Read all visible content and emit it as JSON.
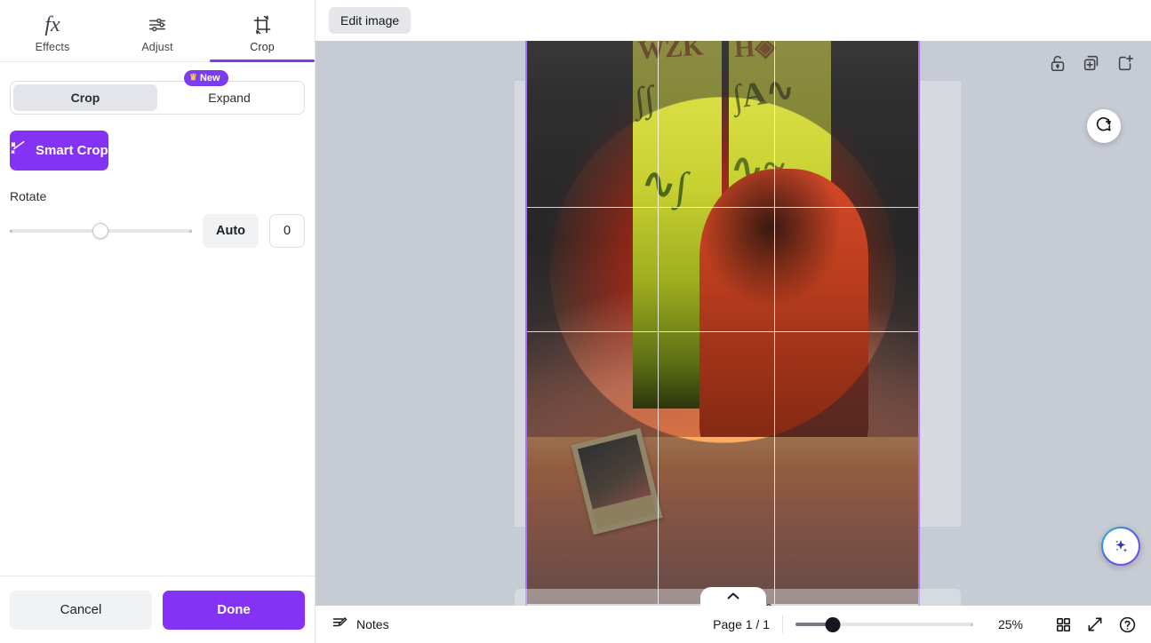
{
  "sidebar": {
    "tabs": [
      {
        "label": "Effects",
        "icon": "fx-icon",
        "active": false
      },
      {
        "label": "Adjust",
        "icon": "sliders-icon",
        "active": false
      },
      {
        "label": "Crop",
        "icon": "crop-rotate-icon",
        "active": true
      }
    ],
    "segment": {
      "crop_label": "Crop",
      "expand_label": "Expand",
      "new_badge": "New",
      "crown_icon": "crown-icon",
      "selected": "Crop"
    },
    "smart_crop": {
      "label": "Smart Crop",
      "icon": "magic-wand-icon",
      "color": "#8433f5"
    },
    "rotate": {
      "label": "Rotate",
      "slider_value": 0,
      "slider_percent": 50,
      "auto_label": "Auto",
      "value_text": "0"
    },
    "footer": {
      "cancel_label": "Cancel",
      "done_label": "Done",
      "done_color": "#8433f5"
    }
  },
  "topbar": {
    "edit_image_label": "Edit image"
  },
  "canvas": {
    "background_color": "#c7cbd4",
    "page_tools": [
      {
        "name": "lock-icon",
        "title": "Lock"
      },
      {
        "name": "duplicate-page-icon",
        "title": "Duplicate page"
      },
      {
        "name": "add-page-icon",
        "title": "Add page"
      }
    ],
    "add_page_label": "+ Add page",
    "comment_icon": "comment-add-icon",
    "magic_icon": "sparkle-icon",
    "collapse_icon": "chevron-up-icon",
    "crop": {
      "shape": "circle",
      "grid": "rule-of-thirds",
      "guide_color": "#a974f7",
      "scrim_color": "rgba(35,38,44,0.46)"
    }
  },
  "statusbar": {
    "notes_label": "Notes",
    "notes_icon": "notes-icon",
    "page_indicator": "Page 1 / 1",
    "zoom_label": "25%",
    "zoom_percent": 21,
    "grid_view_icon": "grid-view-icon",
    "fullscreen_icon": "expand-arrows-icon",
    "help_icon": "help-circle-icon"
  }
}
